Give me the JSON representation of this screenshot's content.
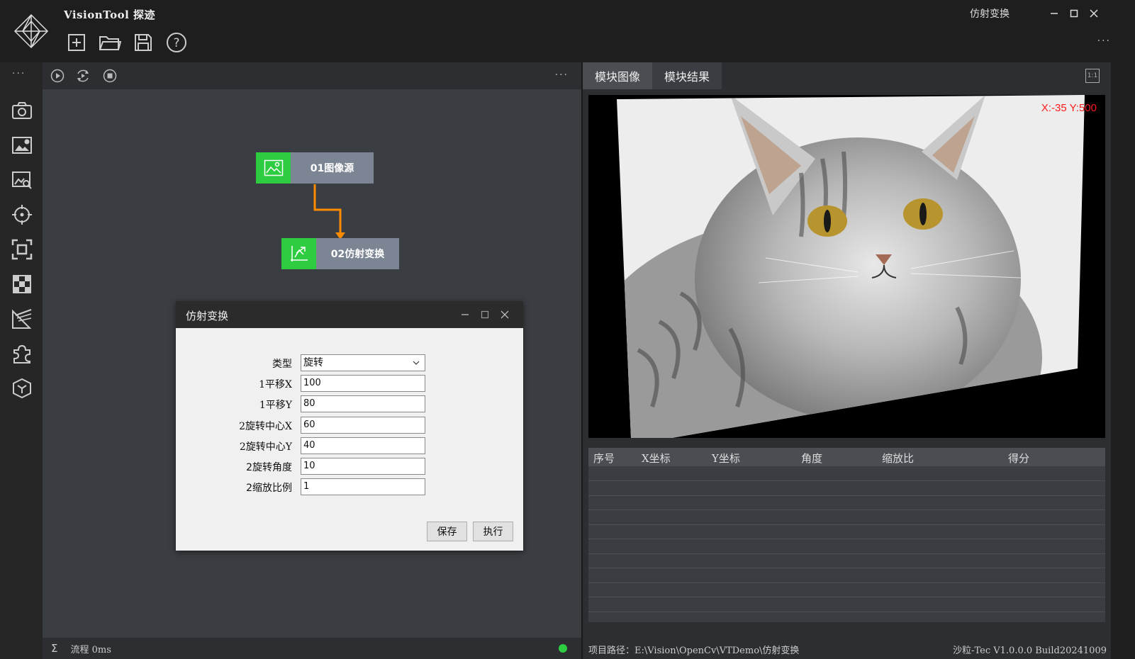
{
  "app": {
    "title": "VisionTool 探迹",
    "window_title": "仿射变换",
    "more": "···"
  },
  "toolbar": {
    "new_icon": "new-file-icon",
    "open_icon": "open-folder-icon",
    "save_icon": "save-icon",
    "help_icon": "help-icon"
  },
  "rail": {
    "more": "···",
    "items": [
      "camera-icon",
      "image-settings-icon",
      "image-search-icon",
      "crosshair-icon",
      "focus-frame-icon",
      "checker-icon",
      "measure-icon",
      "puzzle-icon",
      "cube-icon"
    ]
  },
  "flow": {
    "more": "···",
    "nodes": [
      {
        "label": "01图像源",
        "icon": "image-icon"
      },
      {
        "label": "02仿射变换",
        "icon": "transform-icon"
      }
    ],
    "status_sigma": "Σ",
    "status_text": "流程 0ms",
    "status_color": "#2ecc40"
  },
  "dialog": {
    "title": "仿射变换",
    "fields": [
      {
        "label": "类型",
        "value": "旋转",
        "type": "select"
      },
      {
        "label": "1平移X",
        "value": "100"
      },
      {
        "label": "1平移Y",
        "value": "80"
      },
      {
        "label": "2旋转中心X",
        "value": "60"
      },
      {
        "label": "2旋转中心Y",
        "value": "40"
      },
      {
        "label": "2旋转角度",
        "value": "10"
      },
      {
        "label": "2缩放比例",
        "value": "1"
      }
    ],
    "save_label": "保存",
    "run_label": "执行"
  },
  "right": {
    "tabs": [
      "模块图像",
      "模块结果"
    ],
    "one_to_one": "1:1",
    "coords": "X:-35 Y:500",
    "table_headers": [
      "序号",
      "X坐标",
      "Y坐标",
      "角度",
      "缩放比",
      "得分"
    ],
    "project_path": "项目路径：E:\\Vision\\OpenCv\\VTDemo\\仿射变换",
    "build_info": "沙粒-Tec V1.0.0.0 Build20241009"
  },
  "colors": {
    "accent_green": "#2ecc40",
    "node_grey": "#7b8593",
    "connector_orange": "#ff8c00",
    "coords_red": "#ff1a1a"
  }
}
